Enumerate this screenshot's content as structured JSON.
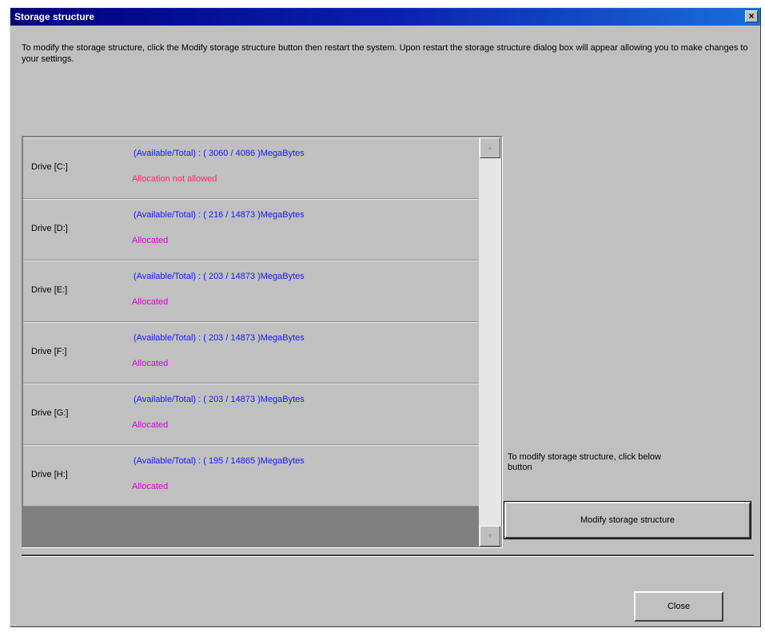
{
  "window": {
    "title": "Storage structure",
    "close_glyph": "×"
  },
  "intro_text": "To modify the storage structure, click the Modify storage structure button then restart the system. Upon restart the storage structure dialog box will appear allowing you to make changes to your settings.",
  "drives": [
    {
      "label": "Drive [C:]",
      "capacity": "(Available/Total) : ( 3060 / 4086 )MegaBytes",
      "status": "Allocation not allowed"
    },
    {
      "label": "Drive [D:]",
      "capacity": "(Available/Total) : ( 216 / 14873 )MegaBytes",
      "status": "Allocated"
    },
    {
      "label": "Drive [E:]",
      "capacity": "(Available/Total) : ( 203 / 14873 )MegaBytes",
      "status": "Allocated"
    },
    {
      "label": "Drive [F:]",
      "capacity": "(Available/Total) : ( 203 / 14873 )MegaBytes",
      "status": "Allocated"
    },
    {
      "label": "Drive [G:]",
      "capacity": "(Available/Total) : ( 203 / 14873 )MegaBytes",
      "status": "Allocated"
    },
    {
      "label": "Drive [H:]",
      "capacity": "(Available/Total) : ( 195 / 14865 )MegaBytes",
      "status": "Allocated"
    }
  ],
  "side_note": "To modify storage structure, click below button",
  "buttons": {
    "modify": "Modify storage structure",
    "close": "Close"
  },
  "scrollbar": {
    "up_icon": "scroll-up-arrow-icon",
    "down_icon": "scroll-down-arrow-icon"
  },
  "colors": {
    "title_bar": "#00007b",
    "capacity_text": "#1a1aff",
    "status_not_allowed": "#ff2a6a",
    "status_allocated": "#d800d8",
    "dialog_face": "#c0c0c0"
  }
}
